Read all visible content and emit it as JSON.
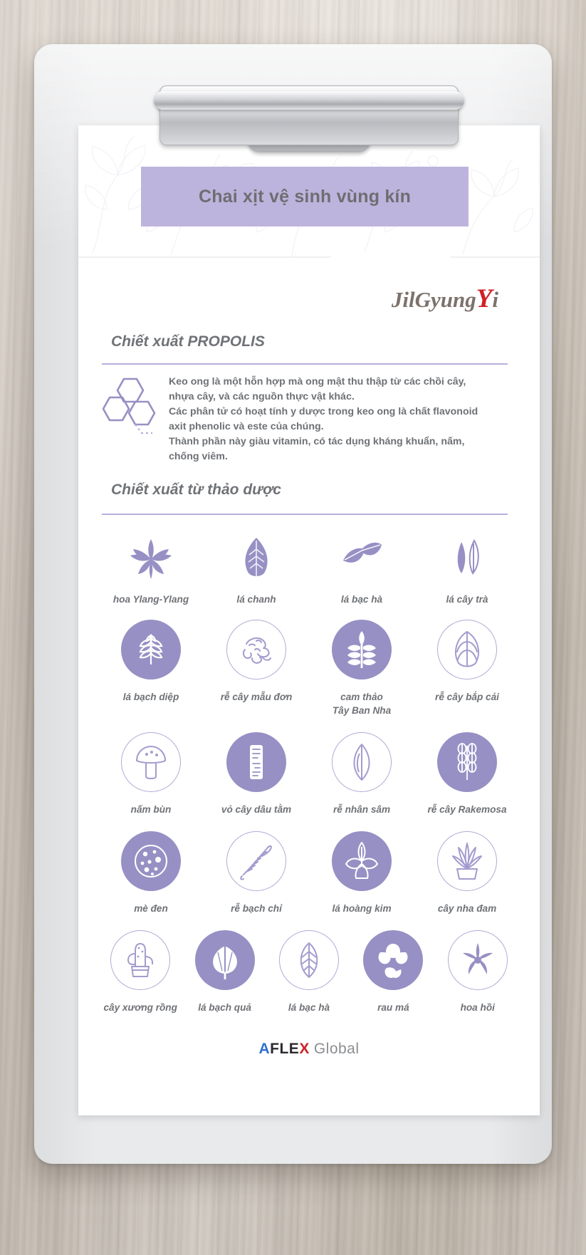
{
  "page": {
    "title_banner": "Chai xịt vệ sinh vùng kín",
    "brand": {
      "part1": "JilGyung",
      "accent": "Y",
      "part2": "i"
    },
    "accent_color": "#9790c4",
    "banner_color": "#bdb4dd",
    "rule_color": "#b7aedb"
  },
  "propolis": {
    "heading": "Chiết xuất PROPOLIS",
    "icon": "hexagon-molecule-icon",
    "lines": [
      "Keo ong là một hỗn hợp mà ong mật thu thập từ các chồi cây,",
      "nhựa cây, và các nguồn thực vật khác.",
      "Các phân tử có hoạt tính y dược trong keo ong là chất flavonoid",
      "axit phenolic và este của chúng.",
      "Thành phần này giàu vitamin, có tác dụng kháng khuẩn, nấm,",
      "chống viêm."
    ]
  },
  "herbs": {
    "heading": "Chiết xuất từ thảo dược",
    "rows": [
      {
        "style": "plain",
        "items": [
          {
            "label": "hoa Ylang-Ylang",
            "icon": "ylang-flower-icon",
            "circle": "none"
          },
          {
            "label": "lá chanh",
            "icon": "lemon-leaf-icon",
            "circle": "none"
          },
          {
            "label": "lá bạc hà",
            "icon": "mint-leaves-icon",
            "circle": "none"
          },
          {
            "label": "lá cây trà",
            "icon": "tea-leaf-icon",
            "circle": "none"
          }
        ]
      },
      {
        "style": "circles",
        "items": [
          {
            "label": "lá bạch diệp",
            "icon": "cypress-leaf-icon",
            "circle": "filled"
          },
          {
            "label": "rễ cây mẫu đơn",
            "icon": "peony-root-icon",
            "circle": "outline"
          },
          {
            "label": "cam thảo\nTây Ban Nha",
            "icon": "licorice-plant-icon",
            "circle": "filled"
          },
          {
            "label": "rễ cây bắp cải",
            "icon": "cabbage-root-icon",
            "circle": "outline"
          }
        ]
      },
      {
        "style": "circles",
        "items": [
          {
            "label": "nấm bùn",
            "icon": "mushroom-icon",
            "circle": "outline"
          },
          {
            "label": "vỏ cây dâu tằm",
            "icon": "mulberry-bark-icon",
            "circle": "filled"
          },
          {
            "label": "rễ nhân sâm",
            "icon": "ginseng-leaf-icon",
            "circle": "outline"
          },
          {
            "label": "rễ cây Rakemosa",
            "icon": "rakemosa-root-icon",
            "circle": "filled"
          }
        ]
      },
      {
        "style": "circles",
        "items": [
          {
            "label": "mè đen",
            "icon": "black-sesame-icon",
            "circle": "filled"
          },
          {
            "label": "rễ bạch chỉ",
            "icon": "angelica-root-icon",
            "circle": "outline"
          },
          {
            "label": "lá hoàng kim",
            "icon": "golden-leaf-icon",
            "circle": "filled"
          },
          {
            "label": "cây nha đam",
            "icon": "aloe-plant-icon",
            "circle": "outline"
          }
        ]
      },
      {
        "style": "circles5",
        "items": [
          {
            "label": "cây xương rồng",
            "icon": "cactus-icon",
            "circle": "outline"
          },
          {
            "label": "lá bạch quả",
            "icon": "ginkgo-leaf-icon",
            "circle": "filled"
          },
          {
            "label": "lá bạc hà",
            "icon": "mint-leaf-icon",
            "circle": "outline"
          },
          {
            "label": "rau má",
            "icon": "centella-icon",
            "circle": "filled"
          },
          {
            "label": "hoa hồi",
            "icon": "star-anise-icon",
            "circle": "outline"
          }
        ]
      }
    ]
  },
  "footer": {
    "a": "A",
    "fle": "FLE",
    "x": "X",
    "global": "Global"
  }
}
